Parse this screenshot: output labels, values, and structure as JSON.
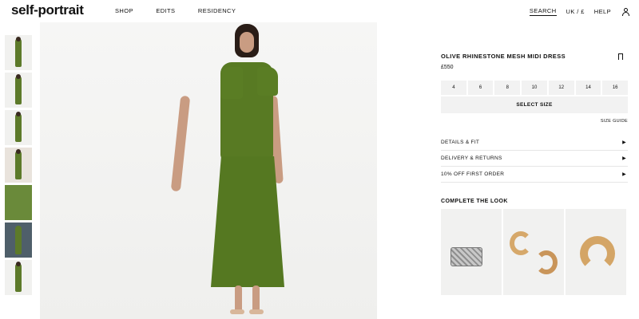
{
  "header": {
    "logo": "self-portrait",
    "nav": [
      "SHOP",
      "EDITS",
      "RESIDENCY"
    ],
    "search": "SEARCH",
    "locale": "UK / £",
    "help": "HELP",
    "account_icon": "user-icon"
  },
  "gallery": {
    "thumbnail_count": 7,
    "dress_color": "#587a23"
  },
  "product": {
    "title": "OLIVE RHINESTONE MESH MIDI DRESS",
    "price": "£550",
    "sizes": [
      "4",
      "6",
      "8",
      "10",
      "12",
      "14",
      "16"
    ],
    "select_size": "SELECT SIZE",
    "size_guide": "SIZE GUIDE",
    "accordion": [
      {
        "label": "DETAILS & FIT"
      },
      {
        "label": "DELIVERY & RETURNS"
      },
      {
        "label": "10% OFF FIRST ORDER"
      }
    ],
    "complete_the_look": "COMPLETE THE LOOK",
    "bookmark_icon": "bookmark-icon",
    "arrow_icon": "caret-right-icon"
  }
}
